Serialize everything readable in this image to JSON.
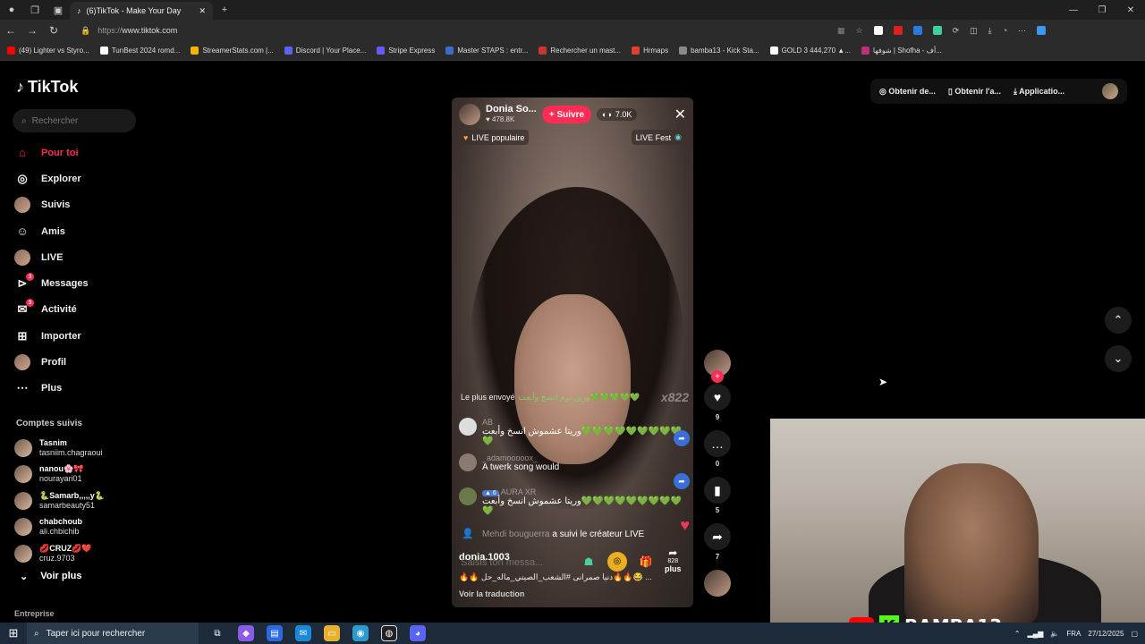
{
  "browser": {
    "tab_title": "(6)TikTok - Make Your Day",
    "url_proto": "https://",
    "url_host": "www.tiktok.com",
    "bookmarks": [
      {
        "label": "(49) Lighter vs Styro...",
        "color": "#ff0000"
      },
      {
        "label": "TunBest 2024 romd...",
        "color": "#ffffff"
      },
      {
        "label": "StreamerStats.com |...",
        "color": "#f5b400"
      },
      {
        "label": "Discord | Your Place...",
        "color": "#5865f2"
      },
      {
        "label": "Stripe Express",
        "color": "#635bff"
      },
      {
        "label": "Master STAPS : entr...",
        "color": "#3a6cc8"
      },
      {
        "label": "Rechercher un mast...",
        "color": "#cc3333"
      },
      {
        "label": "Hrmaps",
        "color": "#e04030"
      },
      {
        "label": "bamba13 - Kick Sta...",
        "color": "#888888"
      },
      {
        "label": "GOLD 3 444,270 ▲...",
        "color": "#ffffff"
      },
      {
        "label": "شوفها | Shofha - أف...",
        "color": "#c0307a"
      }
    ]
  },
  "sidebar": {
    "logo": "TikTok",
    "search_placeholder": "Rechercher",
    "items": [
      {
        "label": "Pour toi",
        "icon": "home",
        "badge": ""
      },
      {
        "label": "Explorer",
        "icon": "compass",
        "badge": ""
      },
      {
        "label": "Suivis",
        "icon": "avatar",
        "badge": ""
      },
      {
        "label": "Amis",
        "icon": "people",
        "badge": ""
      },
      {
        "label": "LIVE",
        "icon": "avatar",
        "badge": ""
      },
      {
        "label": "Messages",
        "icon": "send",
        "badge": "3"
      },
      {
        "label": "Activité",
        "icon": "bell",
        "badge": "3"
      },
      {
        "label": "Importer",
        "icon": "plus-box",
        "badge": ""
      },
      {
        "label": "Profil",
        "icon": "avatar",
        "badge": ""
      },
      {
        "label": "Plus",
        "icon": "dots",
        "badge": ""
      }
    ],
    "following_title": "Comptes suivis",
    "following": [
      {
        "name": "Tasnim",
        "handle": "tasniim.chagraoui"
      },
      {
        "name": "nanou🌸🎀",
        "handle": "nourayari01"
      },
      {
        "name": "🐍Samarb,,,,,y🐍",
        "handle": "samarbeauty51"
      },
      {
        "name": "chabchoub",
        "handle": "ali.chbichib"
      },
      {
        "name": "💋CRUZ💋❤️",
        "handle": "cruz.9703"
      }
    ],
    "see_more": "Voir plus",
    "footer": "Entreprise"
  },
  "top_actions": [
    "Obtenir de...",
    "Obtenir l'a...",
    "Applicatio..."
  ],
  "live": {
    "host_name": "Donia So...",
    "likes": "478.8K",
    "follow_label": "+ Suivre",
    "viewers": "7.0K",
    "chip_left": "LIVE populaire",
    "chip_right": "LIVE Fest",
    "banner_prefix": "Le plus envoyé",
    "banner_text": "ورين ترم انسخ وأبعت💚💚💚💚💚",
    "banner_mult": "x822",
    "comments": [
      {
        "user": "AB",
        "text": "وريتا عشموش انسخ وأبعت💚💚💚💚💚💚💚💚💚💚"
      },
      {
        "user": "_adamooooox_",
        "text": "A twerk song would"
      },
      {
        "user": "AURA XR",
        "level": "6",
        "text": "وريتا عشموش انسخ وأبعت💚💚💚💚💚💚💚💚💚💚"
      }
    ],
    "follow_notice_user": "Mehdi bouguerra",
    "follow_notice_text": "a suivi le créateur LIVE",
    "input_placeholder": "Saisis ton messa...",
    "gift_count": "828",
    "more_label": "plus",
    "host_handle": "donia.1003",
    "caption": "🔥🔥 دنيا صمرانى #الشعب_الصيني_ماله_حل🔥🔥😂 ...",
    "translate": "Voir la traduction"
  },
  "side_actions": [
    {
      "icon": "heart",
      "count": "9"
    },
    {
      "icon": "comment",
      "count": "0"
    },
    {
      "icon": "bookmark",
      "count": "5"
    },
    {
      "icon": "share",
      "count": "7"
    }
  ],
  "overlay": {
    "brand": "BAMBA13"
  },
  "taskbar": {
    "search_placeholder": "Taper ici pour rechercher",
    "lang": "FRA",
    "date": "27/12/2025"
  }
}
